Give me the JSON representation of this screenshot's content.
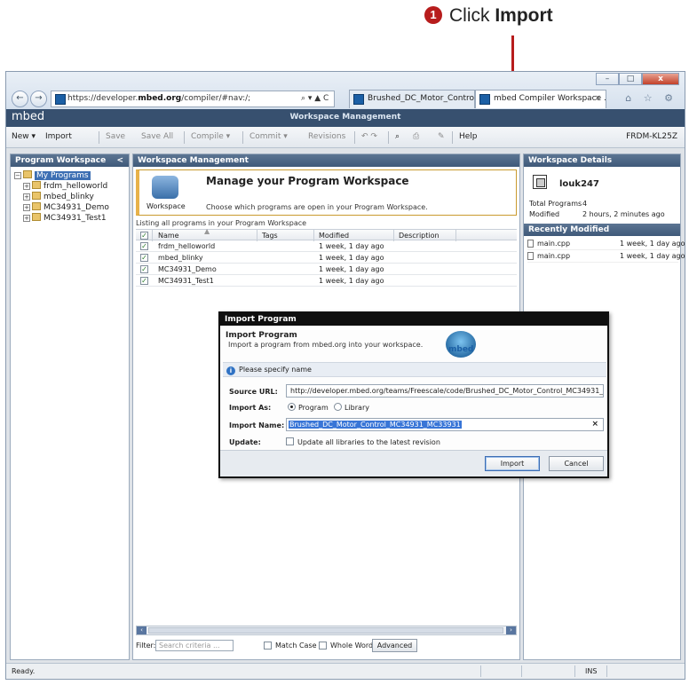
{
  "callout": {
    "number": "1",
    "prefix": "Click ",
    "bold": "Import"
  },
  "browser": {
    "back_glyph": "←",
    "forward_glyph": "→",
    "address_prefix": "https://developer.",
    "address_bold": "mbed.org",
    "address_suffix": "/compiler/#nav:/;",
    "address_controls": "⌕ ▾ ▲ C",
    "tab1_label": "Brushed_DC_Motor_Control_M...",
    "tab2_label": "mbed Compiler Workspace ...",
    "tab2_close": "×",
    "window_buttons": {
      "minimize": "–",
      "maximize": "□",
      "close": "x"
    },
    "toolbar_icons": "⌂ ☆ ⚙"
  },
  "app": {
    "logo": "mbed",
    "title": "Workspace Management"
  },
  "toolbar": {
    "new": "New",
    "import": "Import",
    "save": "Save",
    "save_all": "Save All",
    "compile": "Compile",
    "commit": "Commit",
    "revisions": "Revisions",
    "help": "Help",
    "platform": "FRDM-KL25Z"
  },
  "left_panel": {
    "title": "Program Workspace",
    "collapse": "<",
    "root": "My Programs",
    "items": [
      "frdm_helloworld",
      "mbed_blinky",
      "MC34931_Demo",
      "MC34931_Test1"
    ]
  },
  "main_panel": {
    "title": "Workspace Management",
    "banner_heading": "Manage your Program Workspace",
    "banner_icon_label": "Workspace",
    "banner_sub": "Choose which programs are open in your Program Workspace.",
    "listing_label": "Listing all programs in your Program Workspace",
    "columns": [
      "Name",
      "Tags",
      "Modified",
      "Description"
    ],
    "rows": [
      {
        "name": "frdm_helloworld",
        "tags": "",
        "modified": "1 week, 1 day ago",
        "description": ""
      },
      {
        "name": "mbed_blinky",
        "tags": "",
        "modified": "1 week, 1 day ago",
        "description": ""
      },
      {
        "name": "MC34931_Demo",
        "tags": "",
        "modified": "1 week, 1 day ago",
        "description": ""
      },
      {
        "name": "MC34931_Test1",
        "tags": "",
        "modified": "1 week, 1 day ago",
        "description": ""
      }
    ],
    "filter_label": "Filter:",
    "filter_placeholder": "Search criteria ...",
    "match_case": "Match Case",
    "whole_word": "Whole Word",
    "advanced": "Advanced"
  },
  "right_panel": {
    "title": "Workspace Details",
    "username": "louk247",
    "total_programs_label": "Total Programs",
    "total_programs_value": "4",
    "modified_label": "Modified",
    "modified_value": "2 hours, 2 minutes ago",
    "recent_title": "Recently Modified",
    "recent": [
      {
        "file": "main.cpp",
        "when": "1 week, 1 day ago"
      },
      {
        "file": "main.cpp",
        "when": "1 week, 1 day ago"
      }
    ]
  },
  "status": {
    "ready": "Ready.",
    "ins": "INS"
  },
  "dialog": {
    "title": "Import Program",
    "heading": "Import Program",
    "subheading": "Import a program from mbed.org into your workspace.",
    "logo_text": "mbed",
    "info": "Please specify name",
    "source_url_label": "Source URL:",
    "source_url_value": "http://developer.mbed.org/teams/Freescale/code/Brushed_DC_Motor_Control_MC34931_MC33931/",
    "import_as_label": "Import As:",
    "option_program": "Program",
    "option_library": "Library",
    "import_name_label": "Import Name:",
    "import_name_value": "Brushed_DC_Motor_Control_MC34931_MC33931",
    "clear_glyph": "×",
    "update_label": "Update:",
    "update_text": "Update all libraries to the latest revision",
    "import_button": "Import",
    "cancel_button": "Cancel"
  }
}
